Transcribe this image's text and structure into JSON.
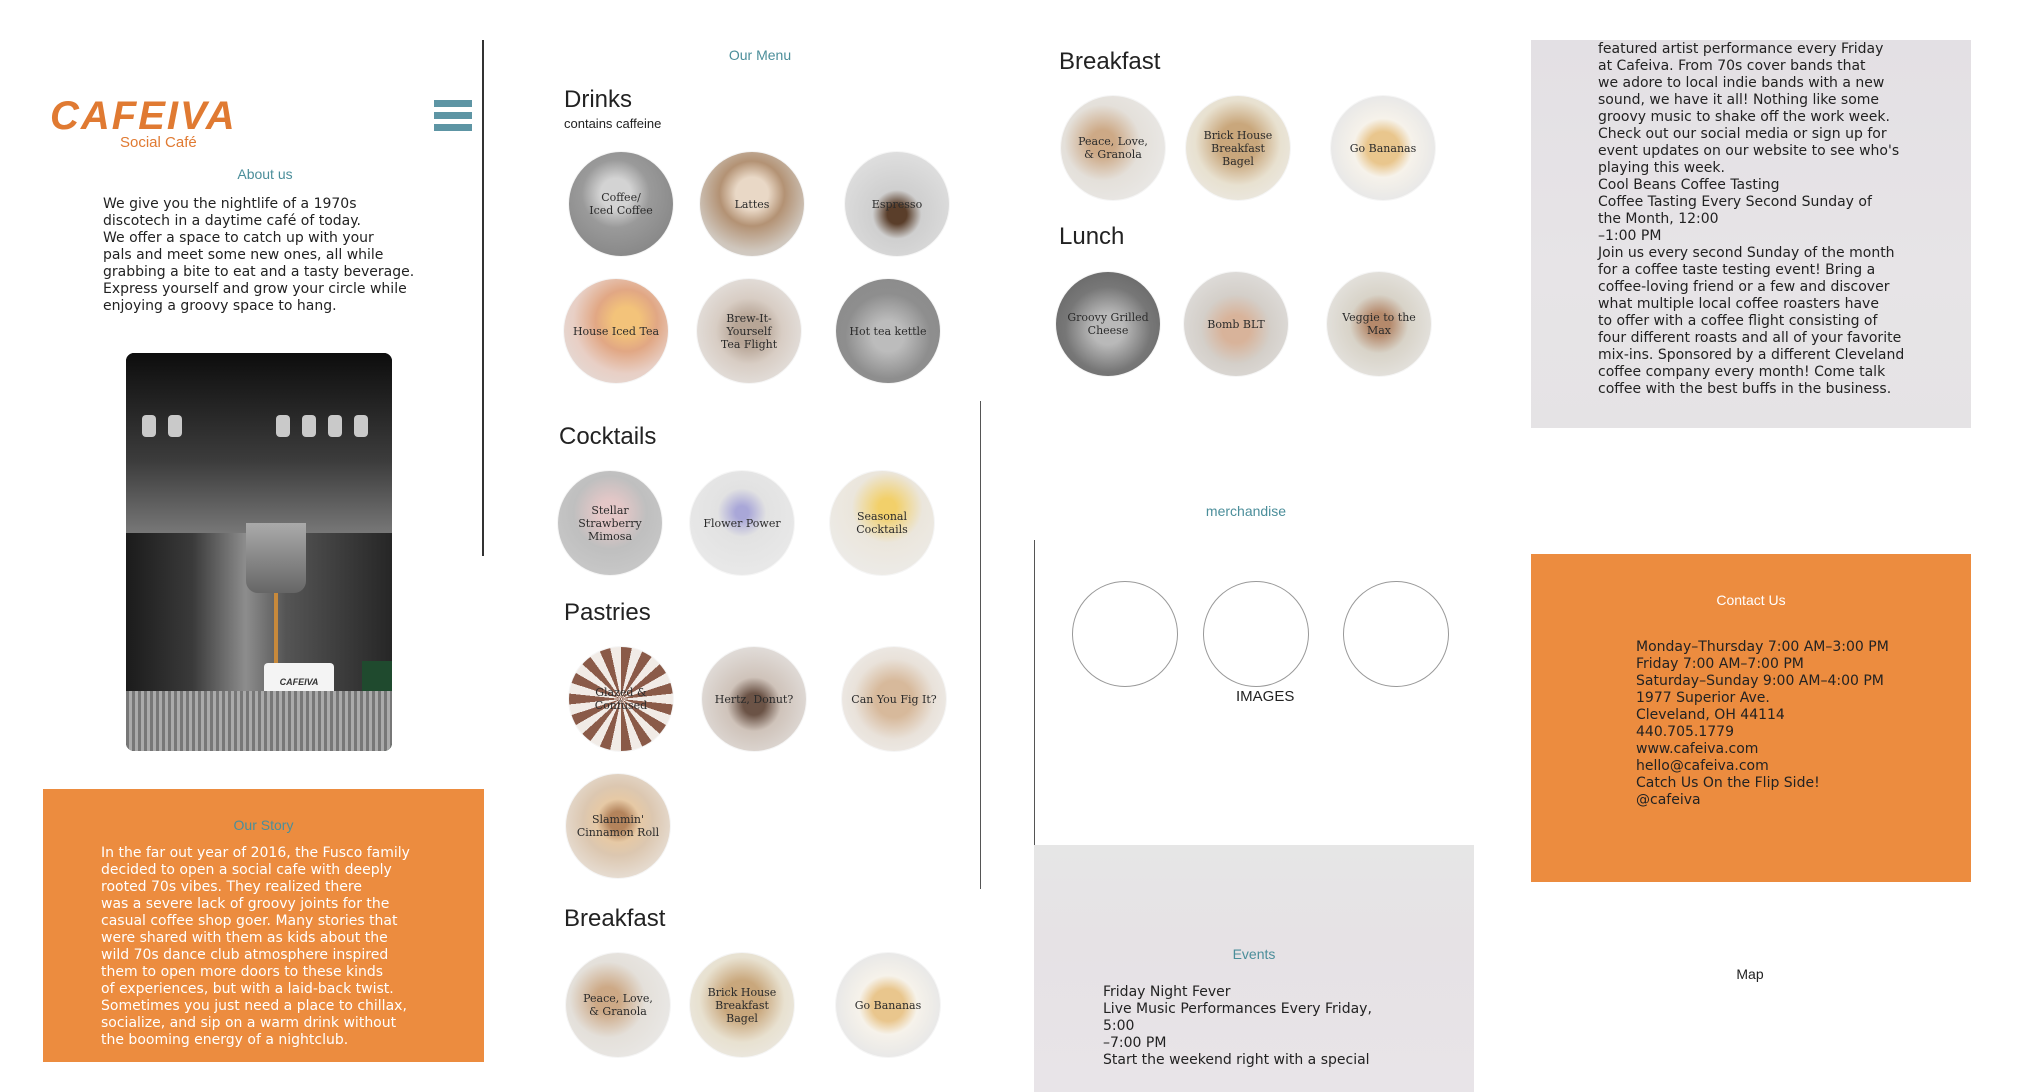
{
  "brand": {
    "logo_text": "CAFEIVA",
    "logo_sub": "Social Café",
    "menu_icon": "hamburger-menu-icon"
  },
  "about": {
    "heading": "About us",
    "text": "We give you the nightlife of a 1970s\ndiscotech in a daytime café of today.\nWe offer a space to catch up with your\npals and meet some new ones, all while\ngrabbing a bite to eat and a tasty beverage.\nExpress yourself and grow your circle while\nenjoying a groovy space to hang.",
    "cup_label": "CAFEIVA"
  },
  "story": {
    "heading": "Our Story",
    "text": "In the far out year of 2016, the Fusco family\ndecided to open a social cafe with deeply\nrooted 70s vibes. They realized there\nwas a severe lack of groovy joints for the\ncasual coffee shop goer. Many stories that\nwere shared with them as kids about the\nwild 70s dance club atmosphere inspired\nthem to open more doors to these kinds\nof experiences, but with a laid-back twist.\nSometimes you just need a place to chillax,\nsocialize, and sip on a warm drink without\nthe booming energy of a nightclub."
  },
  "menu": {
    "heading": "Our Menu",
    "drinks": {
      "title": "Drinks",
      "subtitle": "contains caffeine",
      "items": [
        "Coffee/\nIced Coffee",
        "Lattes",
        "Espresso",
        "House Iced Tea",
        "Brew-It-Yourself\nTea Flight",
        "Hot tea kettle"
      ]
    },
    "cocktails": {
      "title": "Cocktails",
      "items": [
        "Stellar Strawberry\nMimosa",
        "Flower Power",
        "Seasonal\nCocktails"
      ]
    },
    "pastries": {
      "title": "Pastries",
      "items": [
        "Glazed & Confused",
        "Hertz, Donut?",
        "Can You Fig It?",
        "Slammin'\nCinnamon Roll"
      ]
    },
    "breakfast": {
      "title": "Breakfast",
      "items": [
        "Peace, Love,\n& Granola",
        "Brick House\nBreakfast Bagel",
        "Go Bananas"
      ]
    },
    "lunch": {
      "title": "Lunch",
      "items": [
        "Groovy Grilled\nCheese",
        "Bomb BLT",
        "Veggie to the Max"
      ]
    }
  },
  "merch": {
    "heading": "merchandise",
    "images_label": "IMAGES"
  },
  "events": {
    "heading": "Events",
    "text": "Friday Night Fever\nLive Music Performances Every Friday,\n5:00\n–7:00 PM\nStart the weekend right with a special"
  },
  "event_card": {
    "text": "featured artist performance every Friday\nat Cafeiva. From 70s cover bands that\nwe adore to local indie bands with a new\nsound, we have it all! Nothing like some\ngroovy music to shake off the work week.\nCheck out our social media or sign up for\nevent updates on our website to see who's\nplaying this week.\nCool Beans Coffee Tasting\nCoffee Tasting Every Second Sunday of\nthe Month, 12:00\n–1:00 PM\nJoin us every second Sunday of the month\nfor a coffee taste testing event! Bring a\ncoffee-loving friend or a few and discover\nwhat multiple local coffee roasters have\nto offer with a coffee flight consisting of\nfour different roasts and all of your favorite\nmix-ins. Sponsored by a different Cleveland\ncoffee company every month! Come talk\ncoffee with the best buffs in the business."
  },
  "contact": {
    "heading": "Contact Us",
    "lines": [
      "Monday–Thursday 7:00 AM–3:00 PM",
      "Friday 7:00 AM–7:00 PM",
      "Saturday–Sunday 9:00 AM–4:00 PM",
      "1977 Superior Ave.",
      "Cleveland, OH 44114",
      "440.705.1779",
      "www.cafeiva.com",
      "hello@cafeiva.com",
      "Catch Us On the Flip Side!",
      "@cafeiva"
    ]
  },
  "map": {
    "label": "Map"
  },
  "colors": {
    "orange": "#ec8c3f",
    "teal": "#4b8e9a",
    "logo": "#e07a32"
  }
}
